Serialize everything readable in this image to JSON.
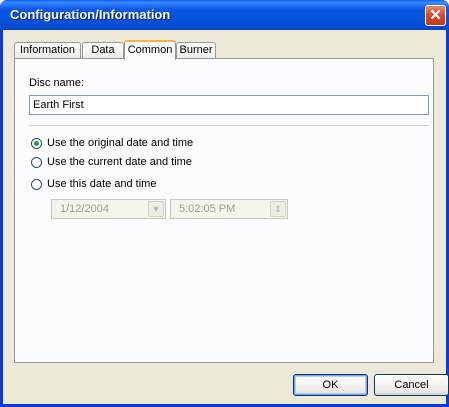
{
  "window": {
    "title": "Configuration/Information",
    "close_glyph": "✕"
  },
  "tabs": [
    {
      "label": "Information",
      "active": false
    },
    {
      "label": "Data",
      "active": false
    },
    {
      "label": "Common",
      "active": true
    },
    {
      "label": "Burner",
      "active": false
    }
  ],
  "common": {
    "disc_name_label": "Disc name:",
    "disc_name_value": "Earth First",
    "date_options": [
      {
        "label": "Use the original date and time",
        "selected": true
      },
      {
        "label": "Use the current date and time",
        "selected": false
      },
      {
        "label": "Use this date and time",
        "selected": false
      }
    ],
    "date_value": "1/12/2004",
    "time_value": "5:02:05 PM"
  },
  "buttons": {
    "ok": "OK",
    "cancel": "Cancel"
  }
}
